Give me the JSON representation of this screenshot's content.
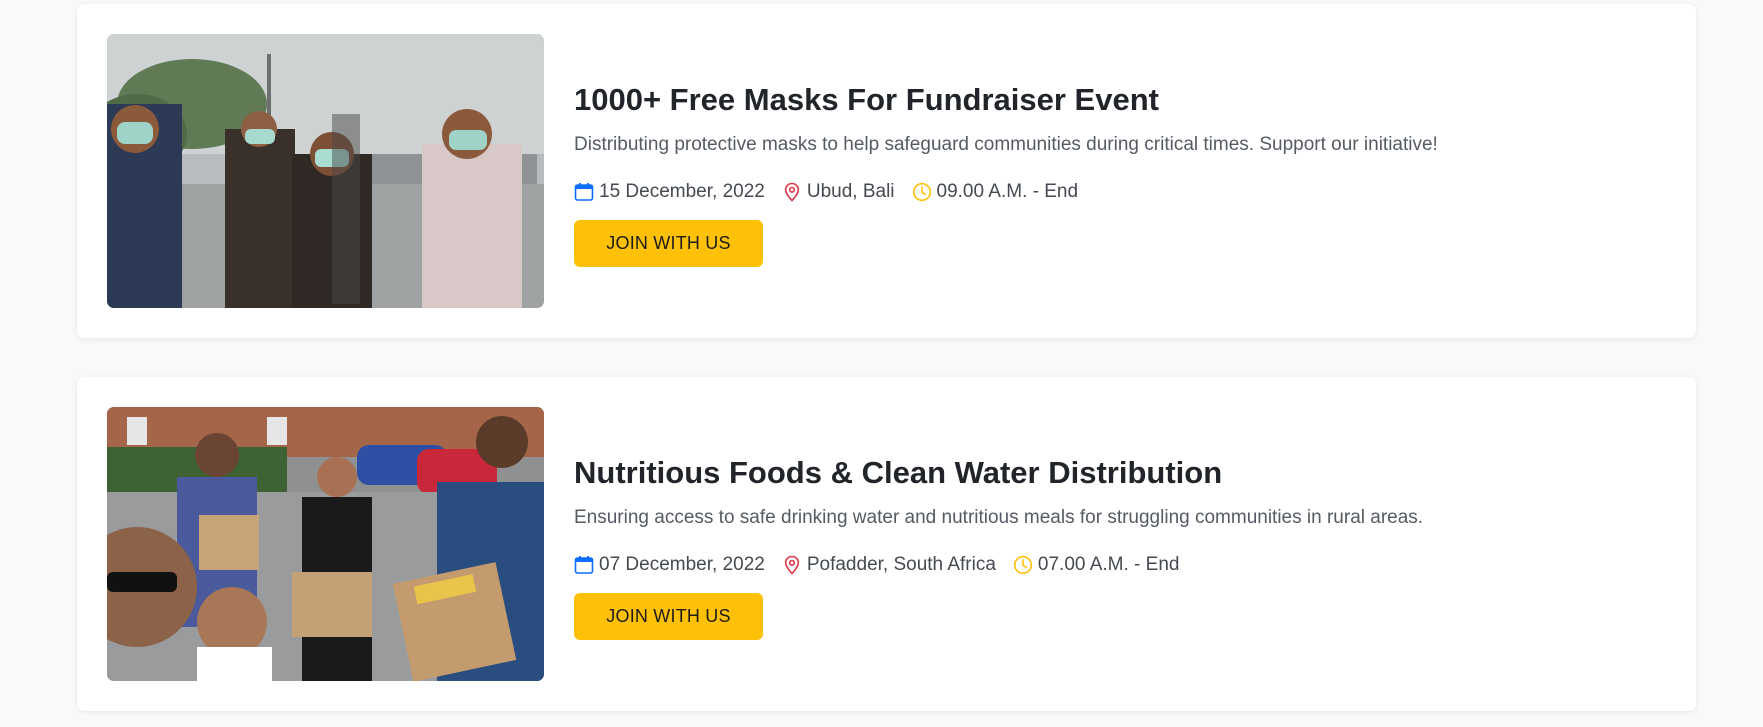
{
  "colors": {
    "page_bg": "#f8f9fb",
    "card_bg": "#ffffff",
    "button_bg": "#ffc107",
    "calendar_icon": "#0d6efd",
    "location_icon": "#dc3545",
    "clock_icon": "#ffc107"
  },
  "events": [
    {
      "image": "photo of students wearing face masks",
      "title": "1000+ Free Masks For Fundraiser Event",
      "description": "Distributing protective masks to help safeguard communities during critical times. Support our initiative!",
      "date": "15 December, 2022",
      "location": "Ubud, Bali",
      "time": "09.00 A.M. - End",
      "button": "JOIN WITH US",
      "icons": [
        "calendar-icon",
        "location-pin-icon",
        "clock-icon"
      ]
    },
    {
      "image": "photo of volunteers holding boxes of food",
      "title": "Nutritious Foods & Clean Water Distribution",
      "description": "Ensuring access to safe drinking water and nutritious meals for struggling communities in rural areas.",
      "date": "07 December, 2022",
      "location": "Pofadder, South Africa",
      "time": "07.00 A.M. - End",
      "button": "JOIN WITH US",
      "icons": [
        "calendar-icon",
        "location-pin-icon",
        "clock-icon"
      ]
    }
  ]
}
